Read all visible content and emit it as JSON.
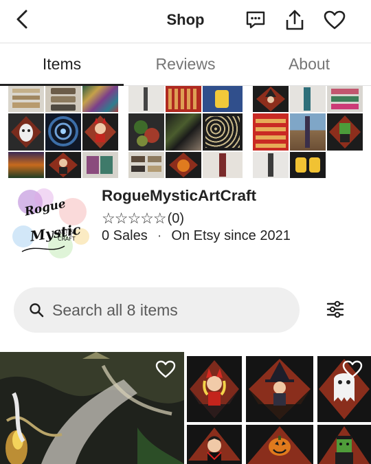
{
  "header": {
    "title": "Shop",
    "back_icon": "chevron-left-icon",
    "actions": [
      "message-icon",
      "share-icon",
      "heart-icon"
    ]
  },
  "tabs": [
    {
      "label": "Items",
      "active": true
    },
    {
      "label": "Reviews",
      "active": false
    },
    {
      "label": "About",
      "active": false
    }
  ],
  "shop": {
    "name": "RogueMysticArtCraft",
    "rating_stars": "☆☆☆☆☆",
    "review_count": "(0)",
    "sales": "0 Sales",
    "separator": "·",
    "since": "On Etsy since 2021",
    "logo": {
      "line1": "Rogue",
      "line2": "Mystic",
      "line3": "ART &",
      "line4": "CRAFT"
    }
  },
  "search": {
    "placeholder": "Search all 8 items",
    "icon": "search-icon",
    "filter_icon": "filter-sliders-icon"
  },
  "colors": {
    "text": "#222222",
    "muted": "#757575",
    "search_bg": "#efefef",
    "divider": "#e1e1e1"
  }
}
